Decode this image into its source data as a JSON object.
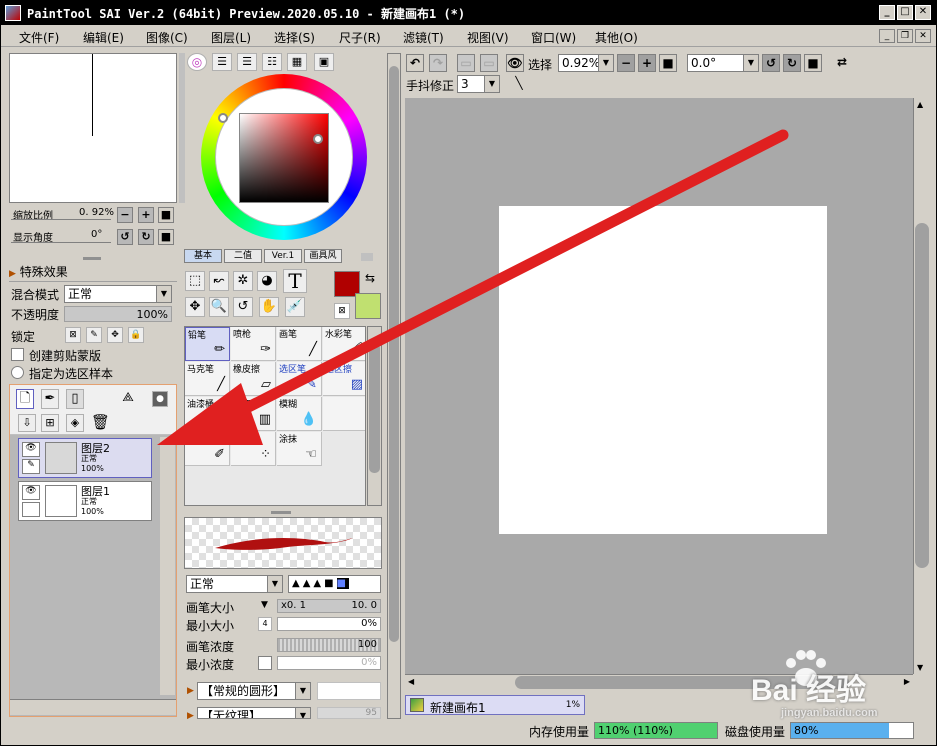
{
  "window": {
    "title": "PaintTool SAI Ver.2 (64bit) Preview.2020.05.10 - 新建画布1 (*)",
    "minimize_icon": "minimize-icon",
    "maximize_icon": "maximize-icon",
    "close_icon": "close-icon"
  },
  "menu": [
    "文件(F)",
    "编辑(E)",
    "图像(C)",
    "图层(L)",
    "选择(S)",
    "尺子(R)",
    "滤镜(T)",
    "视图(V)",
    "窗口(W)",
    "其他(O)"
  ],
  "navigator": {
    "zoom_label": "缩放比例",
    "zoom_value": "0. 92%",
    "angle_label": "显示角度",
    "angle_value": "0°"
  },
  "effects": {
    "header": "特殊效果",
    "blend_label": "混合模式",
    "blend_value": "正常",
    "opacity_label": "不透明度",
    "opacity_value": "100%",
    "lock_label": "锁定",
    "clip_label": "创建剪贴蒙版",
    "sample_label": "指定为选区样本"
  },
  "layers": [
    {
      "name": "图层2",
      "mode": "正常",
      "opacity": "100%",
      "selected": true
    },
    {
      "name": "图层1",
      "mode": "正常",
      "opacity": "100%",
      "selected": false
    }
  ],
  "color": {
    "modes": [
      "基本",
      "二值",
      "Ver.1",
      "画具风"
    ],
    "primary": "#b00000",
    "secondary": "#c0e070"
  },
  "brushes": [
    {
      "name": "铅笔",
      "icon": "pencil-icon",
      "selected": true
    },
    {
      "name": "喷枪",
      "icon": "airbrush-icon",
      "selected": false
    },
    {
      "name": "画笔",
      "icon": "brush-icon",
      "selected": false
    },
    {
      "name": "水彩笔",
      "icon": "watercolor-icon",
      "selected": false
    },
    {
      "name": "马克笔",
      "icon": "marker-icon",
      "selected": false
    },
    {
      "name": "橡皮擦",
      "icon": "eraser-icon",
      "selected": false
    },
    {
      "name": "选区笔",
      "icon": "selpen-icon",
      "selected": false
    },
    {
      "name": "选区擦",
      "icon": "selerase-icon",
      "selected": false
    },
    {
      "name": "油漆桶",
      "icon": "bucket-icon",
      "selected": false
    },
    {
      "name": "渐变",
      "icon": "gradient-icon",
      "selected": false
    },
    {
      "name": "模糊",
      "icon": "blur-icon",
      "selected": false
    },
    {
      "name": "特效笔",
      "icon": "fxpen-icon",
      "selected": false
    },
    {
      "name": "散布",
      "icon": "scatter-icon",
      "selected": false
    },
    {
      "name": "涂抹",
      "icon": "smudge-icon",
      "selected": false
    }
  ],
  "brush_params": {
    "mode": "正常",
    "size_label": "画笔大小",
    "size_mult": "x0. 1",
    "size_value": "10. 0",
    "min_size_label": "最小大小",
    "min_size_value": "0%",
    "density_label": "画笔浓度",
    "density_value": "100",
    "min_density_label": "最小浓度",
    "min_density_value": "0%",
    "shape_label": "【常规的圆形】",
    "texture_label": "【无纹理】",
    "texture_value": "95"
  },
  "canvas_toolbar": {
    "select_label": "选择",
    "zoom_value": "0.92%",
    "angle_value": "0.0°",
    "stabilizer_label": "手抖修正",
    "stabilizer_value": "3"
  },
  "doc_tab": {
    "name": "新建画布1",
    "pct": "1%"
  },
  "status": {
    "mem_label": "内存使用量",
    "mem_value": "110% (110%)",
    "mem_fill": 1.0,
    "mem_color": "#50d070",
    "disk_label": "磁盘使用量",
    "disk_value": "80%",
    "disk_fill": 0.8,
    "disk_color": "#5ab0ee"
  },
  "annotation": {
    "color": "#e02020"
  },
  "watermark": {
    "text": "Bai 经验",
    "url": "jingyan.baidu.com"
  }
}
